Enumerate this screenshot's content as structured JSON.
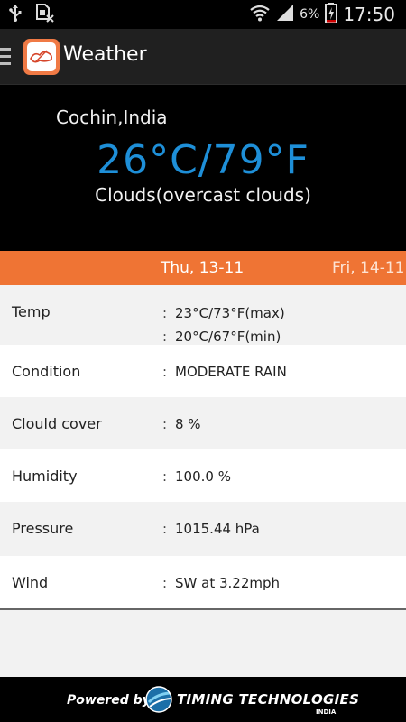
{
  "status_bar": {
    "battery_percent": "6%",
    "time": "17:50",
    "icons": [
      "usb-icon",
      "sim-card-icon",
      "wifi-icon",
      "signal-icon",
      "battery-charging-icon"
    ]
  },
  "action_bar": {
    "title": "Weather",
    "icons": [
      "menu-icon",
      "app-logo-icon"
    ]
  },
  "current": {
    "location": "Cochin,India",
    "temperature": "26°C/79°F",
    "description": "Clouds(overcast clouds)"
  },
  "date_tabs": {
    "active": "Thu, 13-11",
    "next": "Fri, 14-11"
  },
  "details": {
    "temp": {
      "label": "Temp",
      "max": "23°C/73°F(max)",
      "min": "20°C/67°F(min)"
    },
    "condition": {
      "label": "Condition",
      "value": "MODERATE RAIN"
    },
    "cloud_cover": {
      "label": "Clould cover",
      "value": "8 %"
    },
    "humidity": {
      "label": "Humidity",
      "value": "100.0 %"
    },
    "pressure": {
      "label": "Pressure",
      "value": "1015.44 hPa"
    },
    "wind": {
      "label": "Wind",
      "value": "SW at 3.22mph"
    },
    "separator": ":"
  },
  "footer": {
    "powered_by": "Powered by",
    "company": "TIMING TECHNOLOGIES",
    "company_sub": "INDIA"
  },
  "colors": {
    "accent_orange": "#ef7434",
    "temp_blue": "#1e8fd8"
  }
}
